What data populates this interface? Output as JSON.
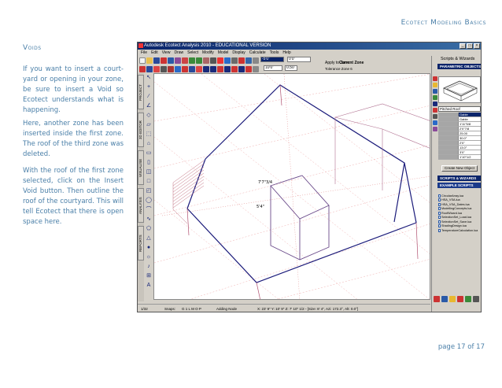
{
  "header": {
    "doc_title": "Ecotect Modeling Basics"
  },
  "section": {
    "title": "Voids"
  },
  "body": {
    "paragraph1": "If you want to insert a court-yard or opening in your zone, be sure to insert a Void so Ecotect understands what is happening.",
    "paragraph2": "Here, another zone has been inserted inside the first zone. The roof of the third zone was deleted.",
    "paragraph3": "With the roof of the first zone selected, click on the Insert Void button. Then outline the roof of the courtyard. This will tell Ecotect that there is open space here."
  },
  "footer": {
    "page_label": "page  17 of 17"
  },
  "app": {
    "window_title": "Autodesk Ecotect Analysis 2010 - EDUCATIONAL VERSION",
    "menu": [
      "File",
      "Edit",
      "View",
      "Draw",
      "Select",
      "Modify",
      "Model",
      "Display",
      "Calculate",
      "Tools",
      "Help"
    ],
    "fields": {
      "x": "-5'0\"",
      "y": "0'0\"",
      "z": "10'0\"",
      "scale": "0.50"
    },
    "zone_label": "Apply to Zone:",
    "current_zone": "Current Zone",
    "zone_small": "Tolerance  Zone 6",
    "left_tabs": [
      "PROJECT",
      "3D EDITOR",
      "VISUALISE",
      "ANALYSIS",
      "REPORTS"
    ],
    "dimension_labels": [
      "7'7\"3/4",
      "5'4\""
    ],
    "status": {
      "page": "1/32",
      "mode": "Snaps:",
      "snaps": "G 1 L M O P",
      "action": "Adding Node",
      "coords": "X: 23' 9\"  Y: 10' 9\"  Z: 7' 10\" 1/2 - [Size: 8' 4\", Azi: 172.3°, Alt: 0.0°]"
    },
    "panel": {
      "title": "Scripts & Wizards",
      "param_header": "PARAMETRIC OBJECTS",
      "select_value": "Pitched Roof",
      "values": [
        "Gable",
        "Gable",
        "1'11\"5/8",
        "2'0\"7/8",
        "25.00",
        "30.0°",
        "2'0\"",
        "13.0°",
        "3'0\"",
        "1'10\"1/2"
      ],
      "create_button": "Create New Object",
      "scripts_header": "SCRIPTS & WIZARDS",
      "example_header": "EXAMPLE SCRIPTS",
      "scripts": [
        "CircularArray.lua",
        "HSA_VSA.lua",
        "HSA_VSA_Dates.lua",
        "ModellingConcepts.lua",
        "RoofWizard.lua",
        "SelectionSet_Load.lua",
        "SelectionSet_Save.lua",
        "ShadingDesign.lua",
        "TemperatureCalculation.lua"
      ]
    }
  }
}
